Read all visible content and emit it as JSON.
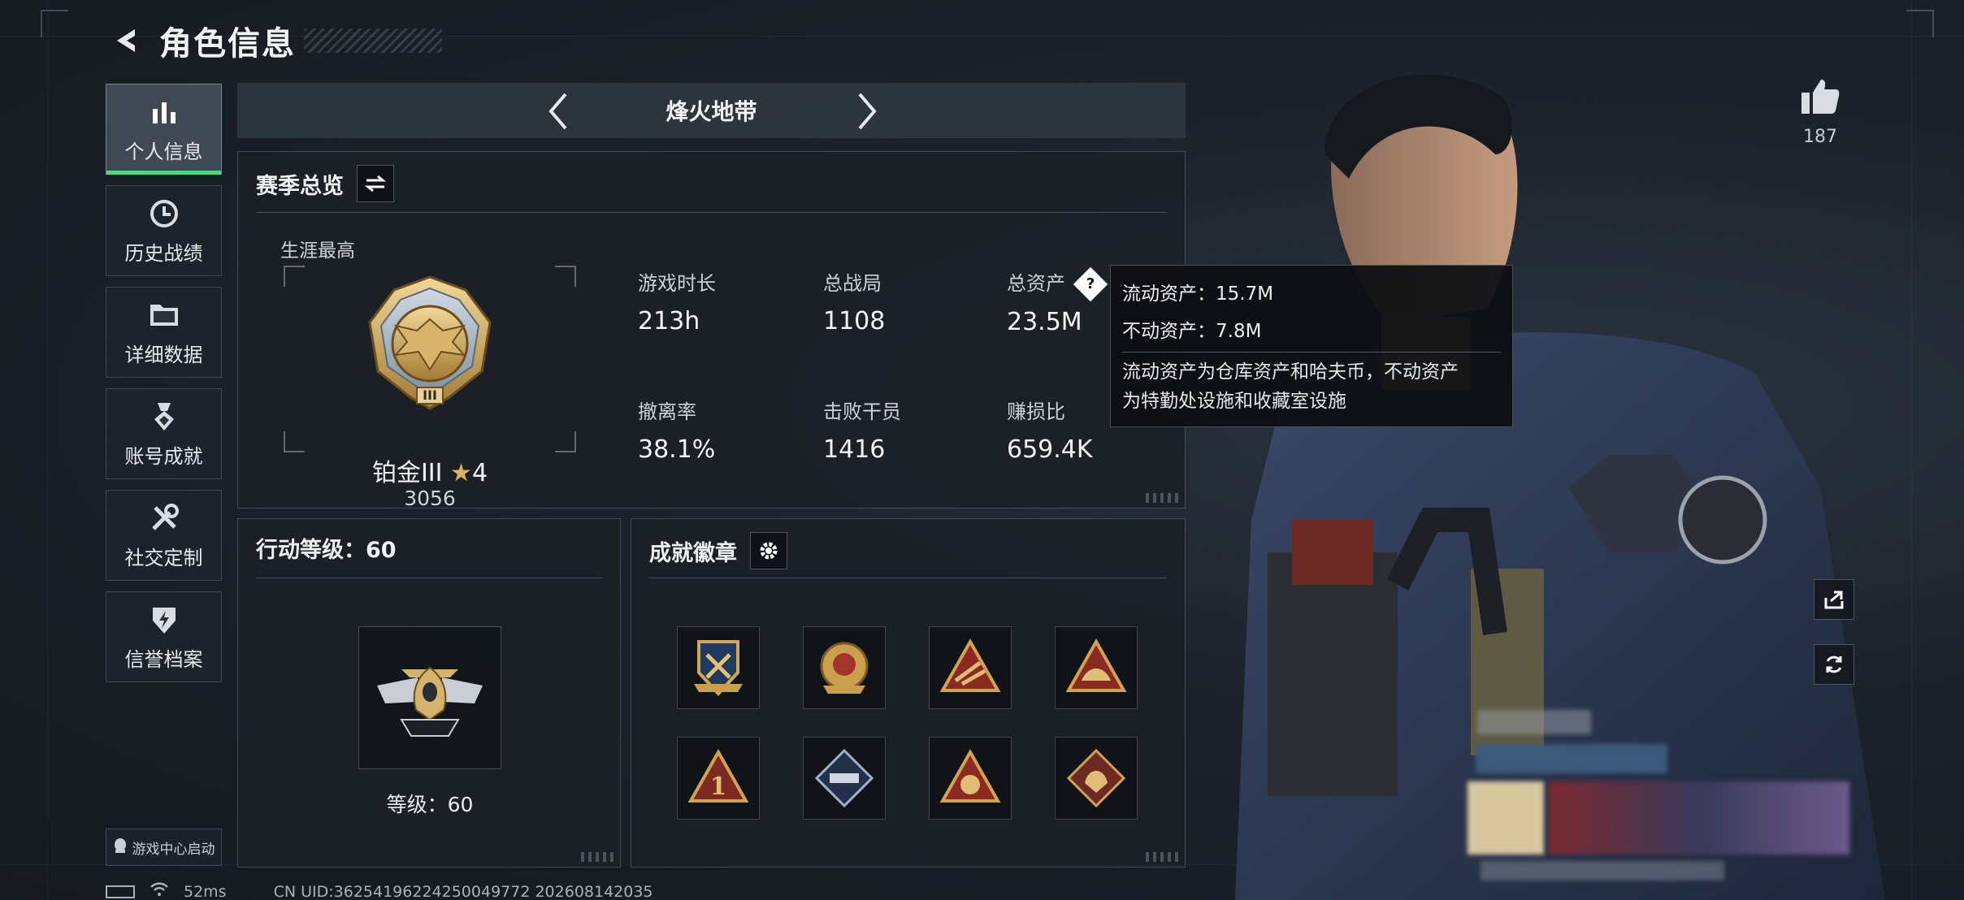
{
  "header": {
    "title": "角色信息"
  },
  "sidebar": {
    "items": [
      {
        "label": "个人信息",
        "icon": "bar-chart-icon",
        "active": true
      },
      {
        "label": "历史战绩",
        "icon": "history-clock-icon"
      },
      {
        "label": "详细数据",
        "icon": "folder-icon"
      },
      {
        "label": "账号成就",
        "icon": "medal-icon"
      },
      {
        "label": "社交定制",
        "icon": "tools-icon"
      },
      {
        "label": "信誉档案",
        "icon": "shield-lightning-icon"
      }
    ],
    "game_center_label": "游戏中心启动"
  },
  "mode": {
    "title": "烽火地带"
  },
  "season": {
    "title": "赛季总览",
    "career_label": "生涯最高",
    "rank_name": "铂金III",
    "rank_stars": "4",
    "rank_score": "3056",
    "rank_numeral": "III",
    "stats": [
      {
        "label": "游戏时长",
        "value": "213h"
      },
      {
        "label": "总战局",
        "value": "1108"
      },
      {
        "label": "总资产",
        "value": "23.5M"
      },
      {
        "label": "撤离率",
        "value": "38.1%"
      },
      {
        "label": "击败干员",
        "value": "1416"
      },
      {
        "label": "赚损比",
        "value": "659.4K"
      }
    ]
  },
  "tooltip": {
    "liquid": "流动资产：15.7M",
    "fixed": "不动资产：7.8M",
    "desc1": "流动资产为仓库资产和哈夫币，不动资产",
    "desc2": "为特勤处设施和收藏室设施"
  },
  "level_panel": {
    "title": "行动等级：60",
    "level_text": "等级：60"
  },
  "badges_panel": {
    "title": "成就徽章",
    "badges": [
      "badge-1-icon",
      "badge-2-icon",
      "badge-3-icon",
      "badge-4-icon",
      "badge-5-icon",
      "badge-6-icon",
      "badge-7-icon",
      "badge-8-icon"
    ]
  },
  "likes": {
    "count": "187"
  },
  "status_bar": {
    "ping": "52ms",
    "uid": "CN UID:36254196224250049772 202608142035"
  },
  "colors": {
    "accent": "#4bd68a",
    "gold": "#c8a45a",
    "panel": "#1b2027"
  }
}
